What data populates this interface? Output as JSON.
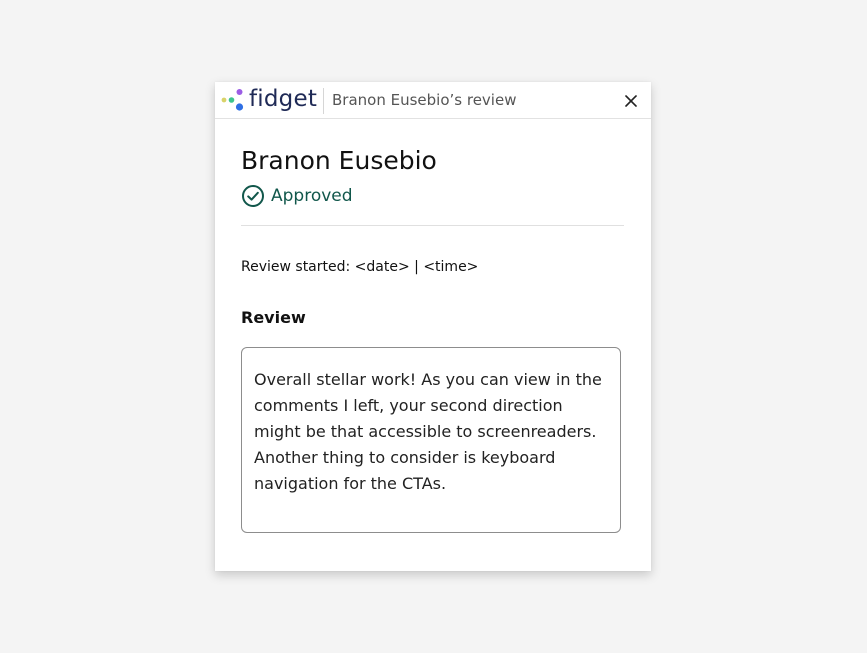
{
  "header": {
    "logo_text": "fidget",
    "title": "Branon Eusebio’s review",
    "close_icon": "close-icon"
  },
  "reviewer": {
    "name": "Branon Eusebio",
    "status_label": "Approved",
    "status_icon": "check-circle-icon",
    "status_color": "#11574b"
  },
  "review": {
    "started_text": "Review started: <date> | <time>",
    "heading": "Review",
    "body": "Overall stellar work! As you can view in the comments I left, your second direction might be that accessible to screenreaders. Another thing to consider is keyboard navigation for the CTAs."
  },
  "colors": {
    "brand_navy": "#1f2a56",
    "logo_yellow": "#d9d36a",
    "logo_green": "#3dc48c",
    "logo_purple": "#9b5de5",
    "logo_blue": "#2f6fe4"
  }
}
